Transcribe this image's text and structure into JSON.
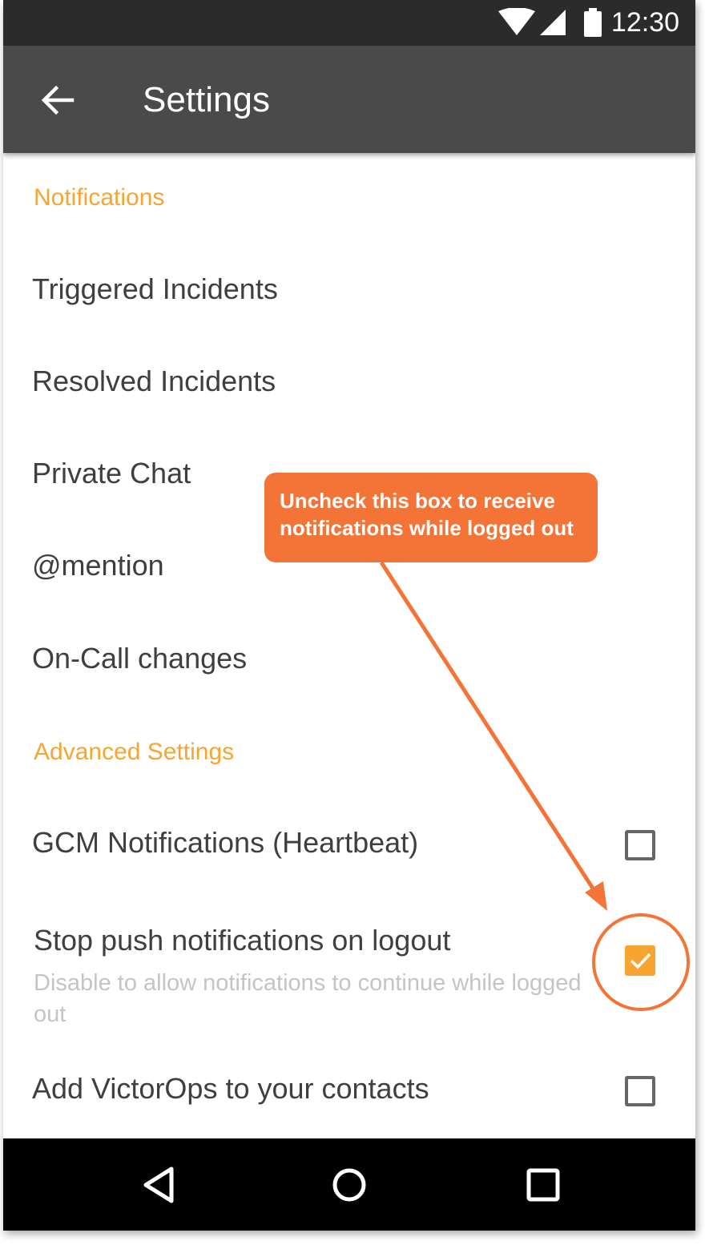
{
  "status_bar": {
    "time": "12:30",
    "icons": [
      "wifi-icon",
      "cellular-signal-icon",
      "battery-icon"
    ]
  },
  "app_bar": {
    "back_icon": "arrow-left-icon",
    "title": "Settings"
  },
  "sections": {
    "notifications": {
      "header": "Notifications",
      "items": [
        {
          "label": "Triggered Incidents"
        },
        {
          "label": "Resolved Incidents"
        },
        {
          "label": "Private Chat"
        },
        {
          "label": "@mention"
        },
        {
          "label": "On-Call changes"
        }
      ]
    },
    "advanced": {
      "header": "Advanced Settings",
      "items": [
        {
          "label": "GCM Notifications (Heartbeat)",
          "checked": false
        },
        {
          "label": "Stop push notifications on logout",
          "summary": "Disable to allow notifications to continue while logged out",
          "checked": true
        },
        {
          "label": "Add VictorOps to your contacts",
          "checked": false
        }
      ]
    }
  },
  "annotation": {
    "callout_text": "Uncheck this box to receive notifications while logged out"
  },
  "nav_bar": {
    "icons": [
      "back-triangle-icon",
      "home-circle-icon",
      "recents-square-icon"
    ]
  },
  "colors": {
    "accent": "#f7a530",
    "app_bar": "#4a4a4a",
    "status_bar": "#2b2b2b",
    "callout": "#f47337",
    "nav_bar": "#000000"
  }
}
